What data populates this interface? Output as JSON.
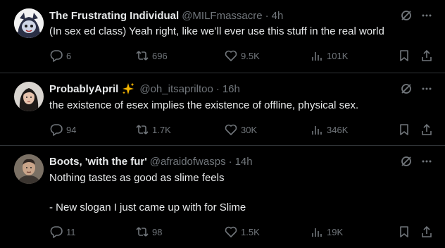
{
  "tweets": [
    {
      "name": "The Frustrating Individual",
      "handle": "@MILFmassacre",
      "time": "4h",
      "lines": [
        "(In sex ed class) Yeah right, like we’ll ever use this stuff in the real world"
      ],
      "replies": "6",
      "reposts": "696",
      "likes": "9.5K",
      "views": "101K"
    },
    {
      "name": "ProbablyApril",
      "handle": "@oh_itsapriltoo",
      "time": "16h",
      "lines": [
        "the existence of esex implies the existence of offline, physical sex."
      ],
      "replies": "94",
      "reposts": "1.7K",
      "likes": "30K",
      "views": "346K"
    },
    {
      "name": "Boots, 'with the fur'",
      "handle": "@afraidofwasps",
      "time": "14h",
      "lines": [
        "Nothing tastes as good as slime feels",
        "- New slogan I just came up with for Slime"
      ],
      "replies": "11",
      "reposts": "98",
      "likes": "1.5K",
      "views": "19K"
    }
  ],
  "icons": {
    "reply": "reply-icon",
    "repost": "repost-icon",
    "like": "like-icon",
    "views": "views-icon",
    "bookmark": "bookmark-icon",
    "share": "share-icon",
    "grok": "grok-icon",
    "more": "more-icon",
    "sparkle": "sparkle-icon"
  },
  "colors": {
    "background": "#000000",
    "text": "#e7e9ea",
    "muted": "#71767b",
    "separator": "#2f3336",
    "sparkle": "#f4b400"
  }
}
